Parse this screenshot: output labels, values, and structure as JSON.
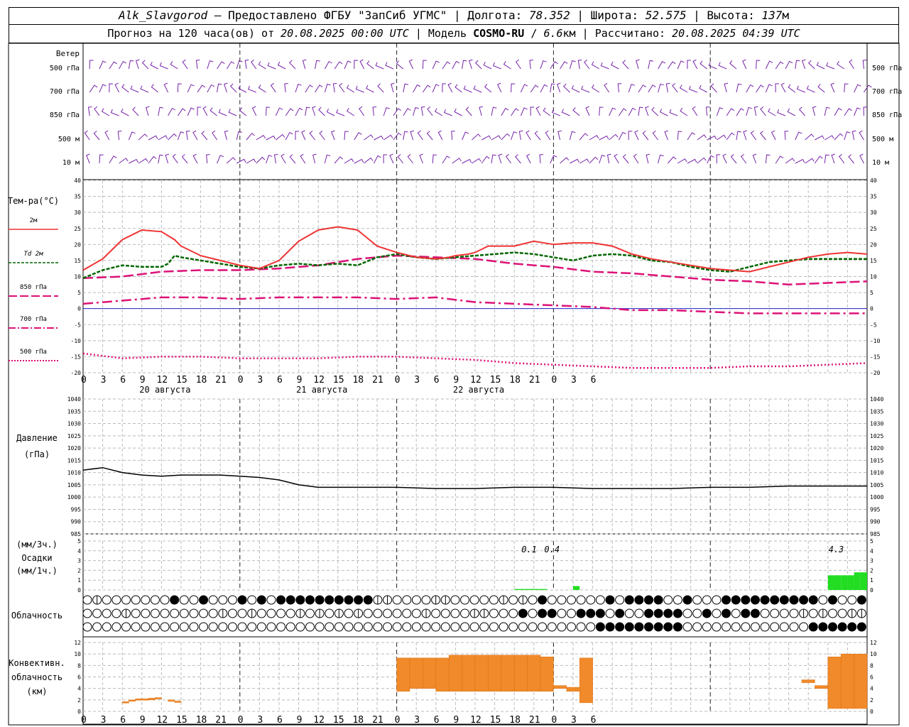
{
  "header": {
    "station": "Alk_Slavgorod",
    "provider": "Предоставлено ФГБУ \"ЗапСиб УГМС\"",
    "longitude_label": "Долгота:",
    "longitude": "78.352",
    "latitude_label": "Широта:",
    "latitude": "52.575",
    "altitude_label": "Высота:",
    "altitude": "137",
    "altitude_unit": "м",
    "forecast_label": "Прогноз на 120 часа(ов) от",
    "forecast_start": "20.08.2025 00:00 UTC",
    "model_label": "Модель",
    "model": "COSMO-RU",
    "resolution": "6.6",
    "resolution_unit": "км",
    "computed_label": "Рассчитано:",
    "computed": "20.08.2025 04:39 UTC"
  },
  "time_axis": {
    "hour_labels": [
      "0",
      "3",
      "6",
      "9",
      "12",
      "15",
      "18",
      "21",
      "0",
      "3",
      "6",
      "9",
      "12",
      "15",
      "18",
      "21",
      "0",
      "3",
      "6",
      "9",
      "12",
      "15",
      "18",
      "21",
      "0",
      "3",
      "6"
    ],
    "day_labels": [
      "20 августа",
      "21 августа",
      "22 августа"
    ]
  },
  "panels": {
    "wind": {
      "title": "Ветер",
      "levels": [
        "500 гПа",
        "700 гПа",
        "850 гПа",
        "500 м",
        "10 м"
      ]
    },
    "temperature": {
      "title": "Тем-ра(°C)",
      "legend": [
        "2м",
        "Td 2м",
        "850 гПа",
        "700 гПа",
        "500 гПа"
      ],
      "ticks": [
        "40",
        "35",
        "30",
        "25",
        "20",
        "15",
        "10",
        "5",
        "0",
        "-5",
        "-10",
        "-15",
        "-20"
      ]
    },
    "pressure": {
      "title_1": "Давление",
      "title_2": "(гПа)",
      "ticks": [
        "1040",
        "1035",
        "1030",
        "1025",
        "1020",
        "1015",
        "1010",
        "1005",
        "1000",
        "995",
        "990",
        "985"
      ]
    },
    "precip": {
      "title_1": "(мм/3ч.)",
      "title_2": "Осадки",
      "title_3": "(мм/1ч.)",
      "ticks": [
        "5",
        "4",
        "3",
        "2",
        "1",
        "0"
      ],
      "annotations": [
        "0.1",
        "0.4",
        "4.3"
      ]
    },
    "cloud": {
      "title": "Облачность"
    },
    "convective": {
      "title_1": "Конвективн.",
      "title_2": "облачность",
      "title_3": "(км)",
      "ticks": [
        "12",
        "10",
        "8",
        "6",
        "4",
        "2",
        "0"
      ]
    }
  },
  "colors": {
    "t2m": "#ee3333",
    "td": "#006600",
    "t850": "#dd1177",
    "t700": "#dd1177",
    "t500": "#dd1177",
    "wind": "#7722aa",
    "pressure": "#000000",
    "precip": "#22dd22",
    "convective": "#f08a2a",
    "zero": "#2222cc"
  },
  "chart_data": [
    {
      "type": "line",
      "title": "Тем-ра(°C)",
      "x_unit": "hours since 20.08.2025 00:00 UTC",
      "ylim": [
        -20,
        40
      ],
      "series": [
        {
          "name": "2м",
          "x": [
            0,
            3,
            6,
            9,
            12,
            14,
            15,
            18,
            21,
            24,
            27,
            30,
            33,
            36,
            39,
            42,
            45,
            48,
            51,
            54,
            56,
            57,
            59,
            60,
            62,
            63,
            66,
            69,
            72,
            75,
            78,
            81,
            84,
            87,
            90,
            93,
            96,
            99,
            102,
            105,
            108,
            111,
            114,
            117,
            120
          ],
          "values": [
            12,
            15.5,
            21.5,
            24.5,
            24,
            21.5,
            19.5,
            16.5,
            15,
            13.5,
            12.5,
            15,
            21,
            24.5,
            25.5,
            24.5,
            19.5,
            17.5,
            16,
            15.5,
            16,
            16.5,
            17,
            17.5,
            19.5,
            19.5,
            19.5,
            21,
            20,
            20.5,
            20.5,
            19.5,
            17,
            15.5,
            14.5,
            13.5,
            12.5,
            12,
            11.5,
            13,
            14.5,
            16,
            17,
            17.5,
            17
          ]
        },
        {
          "name": "Td 2м",
          "x": [
            0,
            3,
            6,
            9,
            12,
            13,
            14,
            15,
            18,
            21,
            24,
            27,
            30,
            33,
            36,
            39,
            42,
            45,
            48,
            51,
            54,
            57,
            60,
            63,
            66,
            69,
            72,
            75,
            78,
            81,
            84,
            87,
            90,
            93,
            96,
            99,
            102,
            105,
            108,
            111,
            114,
            117,
            120
          ],
          "values": [
            9.5,
            12,
            13.5,
            13,
            13,
            14,
            16.5,
            16,
            15,
            14,
            13,
            12.5,
            13.5,
            14,
            13.5,
            14,
            13.5,
            16,
            17,
            16,
            15.5,
            16,
            16.5,
            17,
            17.5,
            17,
            16,
            15,
            16.5,
            17,
            16.5,
            15,
            14.5,
            13,
            12,
            11.5,
            13,
            14.5,
            15,
            15.5,
            15.5,
            15.5,
            15.5
          ]
        },
        {
          "name": "850 гПа",
          "x": [
            0,
            6,
            12,
            18,
            24,
            30,
            36,
            42,
            48,
            54,
            60,
            66,
            72,
            78,
            84,
            90,
            96,
            102,
            108,
            114,
            120
          ],
          "values": [
            9.5,
            10,
            11.5,
            12,
            12,
            12.5,
            13.5,
            15.5,
            16.5,
            16,
            15.5,
            14,
            13,
            11.5,
            11,
            10,
            9,
            8.5,
            7.5,
            8,
            8.5
          ]
        },
        {
          "name": "700 гПа",
          "x": [
            0,
            6,
            12,
            18,
            24,
            30,
            36,
            42,
            48,
            54,
            60,
            66,
            72,
            78,
            84,
            90,
            96,
            102,
            108,
            114,
            120
          ],
          "values": [
            1.5,
            2.5,
            3.5,
            3.5,
            3,
            3.5,
            3.5,
            3.5,
            3,
            3.5,
            2,
            1.5,
            1,
            0.5,
            -0.5,
            -0.5,
            -1,
            -1.5,
            -1.5,
            -1.5,
            -1.5
          ]
        },
        {
          "name": "500 гПа",
          "x": [
            0,
            6,
            12,
            18,
            24,
            30,
            36,
            42,
            48,
            54,
            60,
            66,
            72,
            78,
            84,
            90,
            96,
            102,
            108,
            114,
            120
          ],
          "values": [
            -14,
            -15.5,
            -15,
            -15,
            -15.5,
            -15.5,
            -15.5,
            -15,
            -15,
            -15.5,
            -16,
            -17,
            -17.5,
            -18,
            -18.5,
            -18.5,
            -18.5,
            -18,
            -18,
            -17.5,
            -17
          ]
        }
      ]
    },
    {
      "type": "line",
      "title": "Давление",
      "x_unit": "hours since 20.08.2025 00:00 UTC",
      "ylim": [
        985,
        1040
      ],
      "series": [
        {
          "name": "",
          "x": [
            0,
            3,
            6,
            9,
            12,
            15,
            18,
            21,
            24,
            27,
            30,
            33,
            36,
            42,
            48,
            54,
            60,
            66,
            72,
            78,
            84,
            90,
            96,
            102,
            108,
            114,
            120
          ],
          "values": [
            1011,
            1012,
            1010,
            1009,
            1008.5,
            1009,
            1009,
            1009,
            1008.5,
            1008,
            1007,
            1005,
            1004,
            1004,
            1004,
            1003.5,
            1003.5,
            1004,
            1004,
            1003.5,
            1003.5,
            1003.5,
            1004,
            1004,
            1004.5,
            1004.5,
            1004.5
          ]
        }
      ]
    },
    {
      "type": "bar",
      "title": "Осадки",
      "x_unit": "hours since 20.08.2025 00:00 UTC",
      "ylim": [
        0,
        5
      ],
      "series": [
        {
          "name": "мм/1ч.",
          "x": [
            66,
            67,
            68,
            69,
            70,
            75,
            114,
            115,
            116,
            117,
            118,
            119
          ],
          "values": [
            0.1,
            0.1,
            0.1,
            0.1,
            0.1,
            0.4,
            1.5,
            1.5,
            1.5,
            1.5,
            1.8,
            1.8
          ]
        }
      ]
    },
    {
      "type": "bar",
      "title": "Конвективн. облачность",
      "x_unit": "hours since 20.08.2025 00:00 UTC",
      "ylim": [
        0,
        12
      ],
      "series": [
        {
          "name": "base_km",
          "x": [
            6,
            7,
            8,
            9,
            10,
            11,
            13,
            14,
            48,
            50,
            52,
            54,
            56,
            58,
            60,
            62,
            64,
            66,
            68,
            70,
            72,
            74,
            76,
            110,
            112,
            114,
            116,
            118
          ],
          "values": [
            1.5,
            1.8,
            2,
            2,
            2,
            2.2,
            1.8,
            1.6,
            3.5,
            4,
            4,
            3.5,
            3.5,
            3.5,
            3.5,
            3.5,
            3.5,
            3.5,
            3.5,
            3.5,
            4,
            3.5,
            1.5,
            5,
            4,
            0.5,
            0.5,
            0.5
          ]
        },
        {
          "name": "top_km",
          "x": [
            6,
            7,
            8,
            9,
            10,
            11,
            13,
            14,
            48,
            50,
            52,
            54,
            56,
            58,
            60,
            62,
            64,
            66,
            68,
            70,
            72,
            74,
            76,
            110,
            112,
            114,
            116,
            118
          ],
          "values": [
            1.7,
            2,
            2.2,
            2.2,
            2.3,
            2.4,
            2,
            1.8,
            9.3,
            9.3,
            9.3,
            9.3,
            9.8,
            9.8,
            9.8,
            9.8,
            9.8,
            9.8,
            9.8,
            9.5,
            4.5,
            4.2,
            9.3,
            5.5,
            4.5,
            9.5,
            10,
            10
          ]
        }
      ]
    }
  ]
}
